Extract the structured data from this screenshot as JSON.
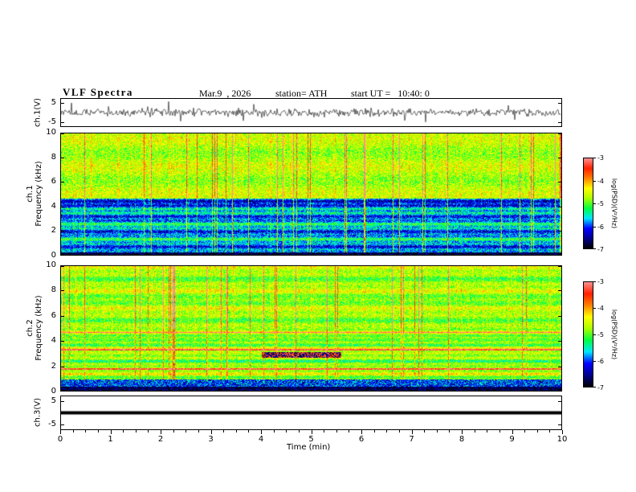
{
  "header": {
    "title": "VLF Spectra",
    "date": "Mar.9  , 2026",
    "station": "station= ATH",
    "start_ut": "start UT =   10:40: 0"
  },
  "xaxis": {
    "label": "Time (min)",
    "ticks": [
      "0",
      "1",
      "2",
      "3",
      "4",
      "5",
      "6",
      "7",
      "8",
      "9",
      "10"
    ],
    "xlim": [
      0,
      10
    ]
  },
  "panels": {
    "wave1": {
      "ylabel": "ch.1(V)",
      "yticks": [
        "5",
        "-5"
      ]
    },
    "spec1": {
      "channel": "ch.1",
      "ylabel": "Frequency (kHz)",
      "yticks": [
        "10",
        "8",
        "6",
        "4",
        "2",
        "0"
      ],
      "ylim": [
        0,
        10
      ]
    },
    "spec2": {
      "channel": "ch.2",
      "ylabel": "Frequency (kHz)",
      "yticks": [
        "10",
        "8",
        "6",
        "4",
        "2",
        "0"
      ],
      "ylim": [
        0,
        10
      ]
    },
    "wave2": {
      "ylabel": "ch.3(V)",
      "yticks": [
        "5",
        "-5"
      ]
    }
  },
  "colorbars": {
    "label": "log(PSD)(V²/Hz)",
    "ticks": [
      "-3",
      "-4",
      "-5",
      "-6",
      "-7"
    ],
    "range": [
      -7,
      -3
    ]
  },
  "colormap": [
    "#000000",
    "#00008b",
    "#0000ff",
    "#00e5ff",
    "#00ff40",
    "#aaff00",
    "#ffff00",
    "#ff8000",
    "#ff2000",
    "#ff9090"
  ],
  "chart_data": [
    {
      "type": "line",
      "name": "ch.1 voltage waveform",
      "xlabel": "Time (min)",
      "xlim": [
        0,
        10
      ],
      "ylabel": "ch.1(V)",
      "yticks": [
        5,
        -5
      ],
      "description": "continuous broadband noise trace centered on 0 V, typical excursions about ±2 V with frequent narrow spikes reaching roughly ±5 V over the full 0-10 min record"
    },
    {
      "type": "heatmap",
      "name": "ch.1 VLF spectrogram",
      "xlabel": "Time (min)",
      "xlim": [
        0,
        10
      ],
      "ylabel": "Frequency (kHz)",
      "ylim": [
        0,
        10
      ],
      "zlabel": "log(PSD)(V²/Hz)",
      "zlim": [
        -7,
        -3
      ],
      "description": "green/yellow PSD near -4.5 above ~5 kHz with many vertical red sferic streaks reaching -3; blue/cyan levels near -6 to -5.5 below ~5 kHz with horizontal banding; near-black band at -7 below ~0.3 kHz"
    },
    {
      "type": "heatmap",
      "name": "ch.2 VLF spectrogram",
      "xlabel": "Time (min)",
      "xlim": [
        0,
        10
      ],
      "ylabel": "Frequency (kHz)",
      "ylim": [
        0,
        10
      ],
      "zlabel": "log(PSD)(V²/Hz)",
      "zlim": [
        -7,
        -3
      ],
      "description": "green/yellow PSD near -4.5 across 1-10 kHz with vertical red streaks; strong horizontal line structure below ~5 kHz including narrow red lines near 1.8, 3.3 and 4.7 kHz; dark band near -7 around 0.5-1 kHz; dark-red patch near 2.8-3.2 kHz between ~4 and 5.5 min"
    },
    {
      "type": "line",
      "name": "ch.3 voltage waveform",
      "xlabel": "Time (min)",
      "xlim": [
        0,
        10
      ],
      "ylabel": "ch.3(V)",
      "yticks": [
        5,
        -5
      ],
      "description": "flat thick black trace constant at 0 V for the full record (channel inactive)"
    }
  ]
}
